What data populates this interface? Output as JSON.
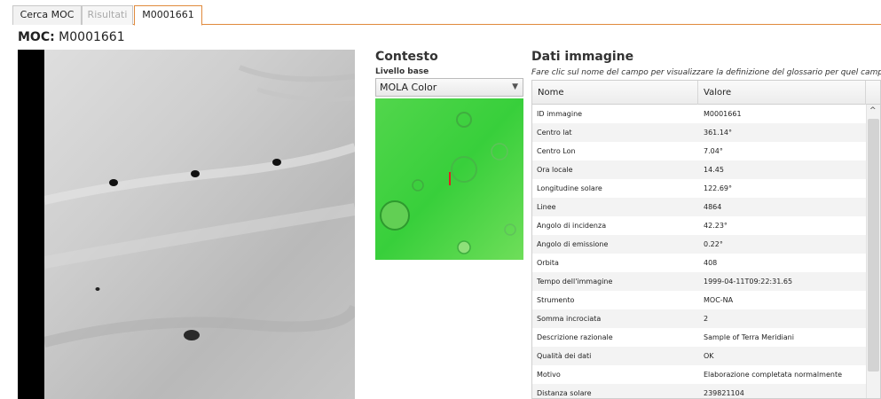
{
  "tabs": [
    {
      "label": "Cerca MOC"
    },
    {
      "label": "Risultati"
    },
    {
      "label": "M0001661"
    }
  ],
  "header": {
    "prefix": "MOC:",
    "id": "M0001661"
  },
  "context": {
    "title": "Contesto",
    "base_label": "Livello base",
    "base_value": "MOLA Color"
  },
  "data_panel": {
    "title": "Dati immagine",
    "hint": "Fare clic sul nome del campo per visualizzare la definizione del glossario per quel campo.",
    "col_name": "Nome",
    "col_value": "Valore",
    "rows": [
      {
        "k": "ID immagine",
        "v": "M0001661"
      },
      {
        "k": "Centro lat",
        "v": "361.14°"
      },
      {
        "k": "Centro Lon",
        "v": "7.04°"
      },
      {
        "k": "Ora locale",
        "v": "14.45"
      },
      {
        "k": "Longitudine solare",
        "v": "122.69°"
      },
      {
        "k": "Linee",
        "v": "4864"
      },
      {
        "k": "Angolo di incidenza",
        "v": "42.23°"
      },
      {
        "k": "Angolo di emissione",
        "v": "0.22°"
      },
      {
        "k": "Orbita",
        "v": "408"
      },
      {
        "k": "Tempo dell'immagine",
        "v": "1999-04-11T09:22:31.65"
      },
      {
        "k": "Strumento",
        "v": "MOC-NA"
      },
      {
        "k": "Somma incrociata",
        "v": "2"
      },
      {
        "k": "Descrizione razionale",
        "v": "Sample of Terra Meridiani"
      },
      {
        "k": "Qualità dei dati",
        "v": "OK"
      },
      {
        "k": "Motivo",
        "v": "Elaborazione completata normalmente"
      },
      {
        "k": "Distanza solare",
        "v": "239821104"
      }
    ]
  },
  "icons": {
    "select_caret": "chevron-down-icon",
    "scroll_up": "chevron-up-icon"
  },
  "colors": {
    "tab_accent": "#e08a3c",
    "map_green": "#3dd33d",
    "marker_red": "#e02020"
  }
}
